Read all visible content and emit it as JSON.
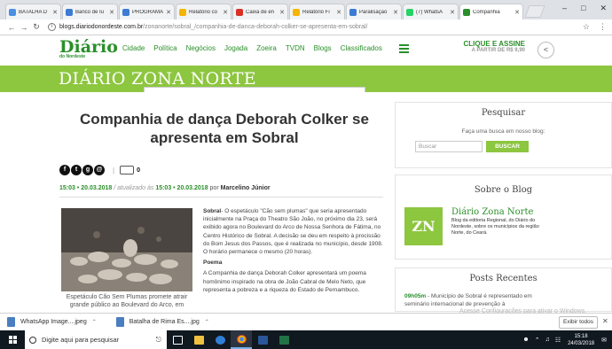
{
  "browser": {
    "tabs": [
      {
        "label": "BATALHA D",
        "color": "#4a90e2"
      },
      {
        "label": "Banco de Iu",
        "color": "#3b7bd4"
      },
      {
        "label": "PROGRAMA",
        "color": "#3b7bd4"
      },
      {
        "label": "Relatório co",
        "color": "#f5b400"
      },
      {
        "label": "Caixa de en",
        "color": "#d93025"
      },
      {
        "label": "Relatório Fi",
        "color": "#f5b400"
      },
      {
        "label": "Paralisação",
        "color": "#3b7bd4"
      },
      {
        "label": "(7) WhatsA",
        "color": "#25d366"
      },
      {
        "label": "Companhia",
        "color": "#2a8f2a"
      }
    ],
    "window_controls": [
      "–",
      "□",
      "✕"
    ],
    "url_domain": "blogs.diariodonordeste.com.br",
    "url_path": "/zonanorte/sobral_/companhia-de-danca-deborah-colker-se-apresenta-em-sobral/"
  },
  "site": {
    "logo_main": "Diário",
    "logo_sub": "do Nordeste",
    "nav": [
      "Cidade",
      "Política",
      "Negócios",
      "Jogada",
      "Zoeira",
      "TVDN",
      "Blogs",
      "Classificados"
    ],
    "cta_line1": "CLIQUE E ASSINE",
    "cta_line2": "A PARTIR DE R$ 9,90",
    "banner_title": "DIÁRIO ZONA NORTE"
  },
  "article": {
    "title": "Companhia de dança Deborah Colker se apresenta em Sobral",
    "comment_count": "0",
    "date": "15:03 • 20.03.2018",
    "updated": " / atualizado às ",
    "updated_date": "15:03 • 20.03.2018",
    "by": " por ",
    "author": "Marcelino Júnior",
    "caption": "Espetáculo Cão Sem Plumas promete atrair grande público ao Boulevard do Arco, em",
    "para1_lead": "Sobral",
    "para1": "- O espetáculo \"Cão sem plumas\" que seria apresentado inicialmente na Praça do Theatro São João, no próximo dia 23, será exibido agora no Boulevard do Arco de Nossa Senhora de Fátima, no Centro Histórico de Sobral. A decisão se deu em respeito à procissão do Bom Jesus dos Passos, que é realizada no município, desde 1908. O horário permanece o mesmo (20 horas).",
    "subhead": "Poema",
    "para2": "A Companhia de dança Deborah Colker apresentará um poema homônimo inspirado na obra de João Cabral de Melo Neto, que representa a pobreza e a riqueza do Estado de Pernambuco."
  },
  "sidebar": {
    "search_title": "Pesquisar",
    "search_label": "Faça uma busca em nosso blog:",
    "search_placeholder": "Buscar",
    "search_button": "BUSCAR",
    "about_title": "Sobre o Blog",
    "about_logo": "ZN",
    "about_name": "Diário Zona Norte",
    "about_desc": "Blog da editoria Regional, do Diário do Nordeste, sobre os municípios da região Norte, do Ceará.",
    "posts_title": "Posts Recentes",
    "post1_time": "09h05m",
    "post1_text": " - Município de Sobral é representado em seminário internacional de prevenção à"
  },
  "overlay": {
    "activate_text": "Acesse Configurações para ativar o Windows."
  },
  "downloads": {
    "items": [
      {
        "label": "WhatsApp Image....jpeg"
      },
      {
        "label": "Batalha de Rima Es....jpg"
      }
    ],
    "show_all": "Exibir todos"
  },
  "taskbar": {
    "search_placeholder": "Digite aqui para pesquisar",
    "time": "15:18",
    "date": "24/03/2018",
    "tray_icons": [
      "person-icon",
      "chevron-up-icon",
      "volume-icon",
      "network-icon",
      "notification-icon"
    ]
  }
}
